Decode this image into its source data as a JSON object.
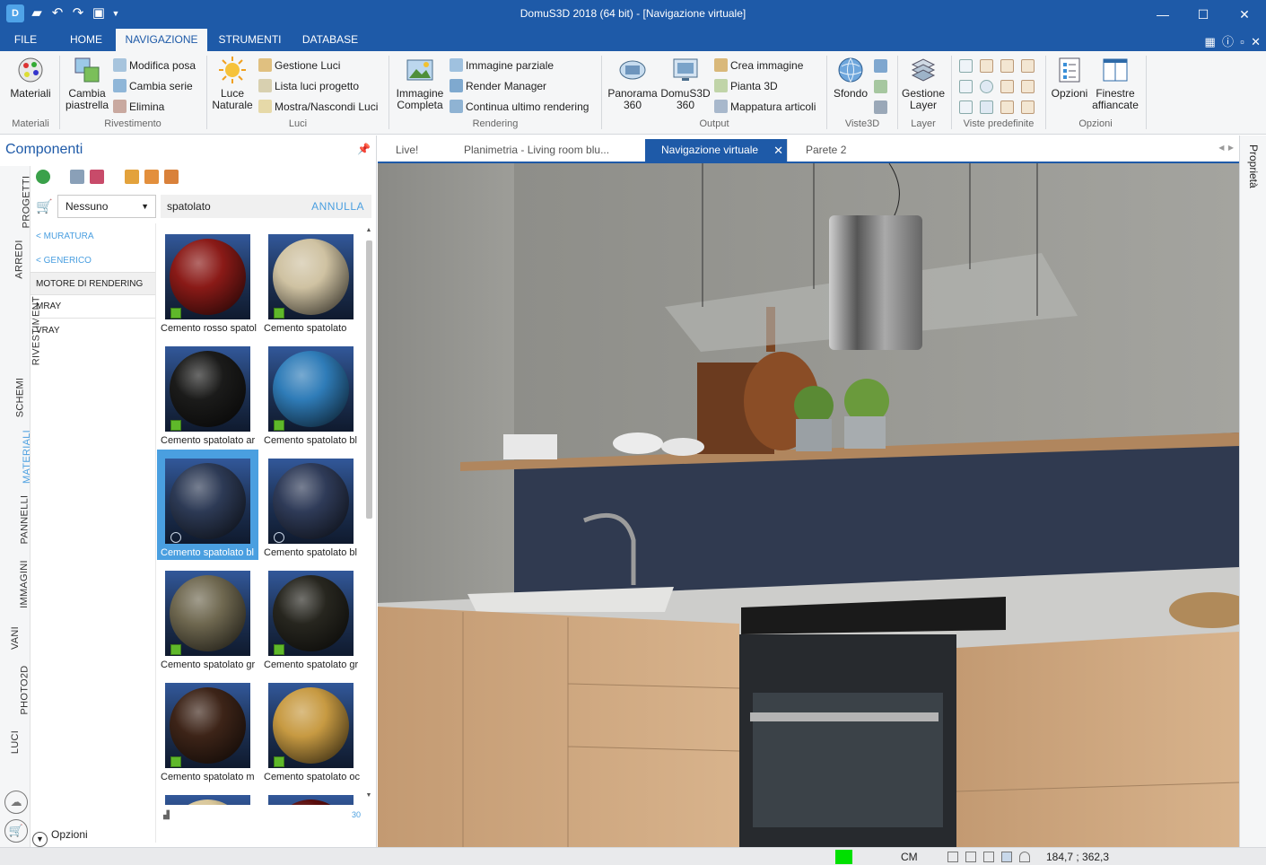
{
  "window": {
    "title": "DomuS3D 2018 (64 bit) - [Navigazione virtuale]",
    "logo": "D",
    "controls": {
      "minimize": "—",
      "maximize": "☐",
      "close": "✕"
    }
  },
  "ribbon": {
    "tabs": [
      {
        "label": "FILE",
        "active": false
      },
      {
        "label": "HOME",
        "active": false
      },
      {
        "label": "NAVIGAZIONE",
        "active": true
      },
      {
        "label": "STRUMENTI",
        "active": false
      },
      {
        "label": "DATABASE",
        "active": false
      }
    ],
    "groups": {
      "materiali": {
        "label": "Materiali",
        "button": "Materiali"
      },
      "rivestimento": {
        "label": "Rivestimento",
        "big": [
          "Cambia",
          "piastrella"
        ],
        "small": [
          "Modifica posa",
          "Cambia serie",
          "Elimina"
        ]
      },
      "luci": {
        "label": "Luci",
        "big": [
          "Luce",
          "Naturale"
        ],
        "small": [
          "Gestione Luci",
          "Lista luci progetto",
          "Mostra/Nascondi Luci"
        ]
      },
      "rendering": {
        "label": "Rendering",
        "big": [
          "Immagine",
          "Completa"
        ],
        "small": [
          "Immagine parziale",
          "Render Manager",
          "Continua ultimo rendering"
        ]
      },
      "output": {
        "label": "Output",
        "big1": [
          "Panorama",
          "360"
        ],
        "big2": [
          "DomuS3D",
          "360"
        ],
        "small": [
          "Crea immagine",
          "Pianta 3D",
          "Mappatura articoli"
        ]
      },
      "viste3d": {
        "label": "Viste3D",
        "button": "Sfondo"
      },
      "layer": {
        "label": "Layer",
        "button": [
          "Gestione",
          "Layer"
        ]
      },
      "viste_predefinite": {
        "label": "Viste predefinite"
      },
      "opzioni": {
        "label": "Opzioni",
        "button1": "Opzioni",
        "button2": [
          "Finestre",
          "affiancate"
        ]
      }
    }
  },
  "components": {
    "title": "Componenti",
    "vertical_tabs": [
      "PROGETTI",
      "ARREDI",
      "RIVESTIMENTI",
      "SCHEMI",
      "MATERIALI",
      "PANNELLI",
      "IMMAGINI",
      "VANI",
      "PHOTO2D",
      "LUCI"
    ],
    "active_vertical_tab": "MATERIALI",
    "filter_select": "Nessuno",
    "search_value": "spatolato",
    "cancel_label": "ANNULLA",
    "categories": [
      {
        "label": "MURATURA",
        "kind": "back"
      },
      {
        "label": "GENERICO",
        "kind": "back"
      },
      {
        "label": "MOTORE DI RENDERING",
        "kind": "selected"
      },
      {
        "label": "MRAY",
        "kind": "item"
      },
      {
        "label": "VRAY",
        "kind": "item"
      }
    ],
    "materials": [
      {
        "label": "Cemento rosso spatol",
        "color": "#8a1a17",
        "badge": "cube",
        "selected": false
      },
      {
        "label": "Cemento spatolato",
        "color": "#cfc2a2",
        "badge": "cube",
        "selected": false
      },
      {
        "label": "Cemento spatolato ar",
        "color": "#1b1b1a",
        "badge": "cube",
        "selected": false
      },
      {
        "label": "Cemento spatolato bl",
        "color": "#2f7cb8",
        "badge": "cube",
        "selected": false
      },
      {
        "label": "Cemento spatolato bl",
        "color": "#2d3a55",
        "badge": "check",
        "selected": true
      },
      {
        "label": "Cemento spatolato bl",
        "color": "#2f3b58",
        "badge": "check",
        "selected": false
      },
      {
        "label": "Cemento spatolato gr",
        "color": "#6f6850",
        "badge": "cube",
        "selected": false
      },
      {
        "label": "Cemento spatolato gr",
        "color": "#27261f",
        "badge": "cube",
        "selected": false
      },
      {
        "label": "Cemento spatolato m",
        "color": "#3d2418",
        "badge": "cube",
        "selected": false
      },
      {
        "label": "Cemento spatolato oc",
        "color": "#c79a42",
        "badge": "cube",
        "selected": false
      },
      {
        "label": "",
        "color": "#d9c79a",
        "badge": "none",
        "selected": false
      },
      {
        "label": "",
        "color": "#5a0d0d",
        "badge": "none",
        "selected": false
      }
    ],
    "count": "30",
    "options_label": "Opzioni"
  },
  "document_tabs": [
    {
      "label": "Live!",
      "active": false
    },
    {
      "label": "Planimetria - Living room blu...",
      "active": false
    },
    {
      "label": "Navigazione virtuale",
      "active": true
    },
    {
      "label": "Parete 2",
      "active": false
    }
  ],
  "properties_label": "Proprietà",
  "statusbar": {
    "units": "CM",
    "coordinates": "184,7 ; 362,3",
    "led_color": "#00e000"
  },
  "colors": {
    "brand_blue": "#1e5aa8",
    "accent_light_blue": "#4a9fe0"
  }
}
